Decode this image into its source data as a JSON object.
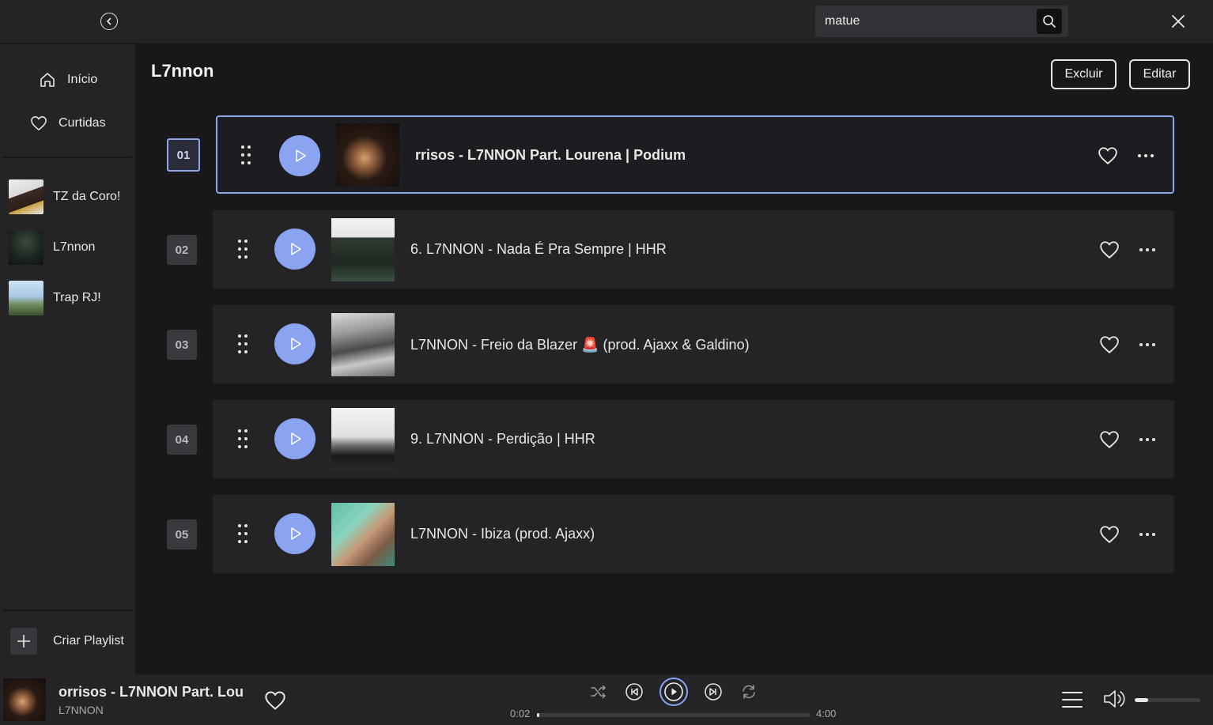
{
  "sidebar": {
    "nav": [
      {
        "label": "Início",
        "icon": "home-icon"
      },
      {
        "label": "Curtidas",
        "icon": "heart-icon"
      }
    ],
    "playlists": [
      {
        "name": "TZ da Coro!"
      },
      {
        "name": "L7nnon"
      },
      {
        "name": "Trap RJ!"
      }
    ],
    "create_label": "Criar Playlist"
  },
  "topbar": {
    "search_value": "matue"
  },
  "playlist": {
    "title": "L7nnon",
    "delete_label": "Excluir",
    "edit_label": "Editar",
    "tracks": [
      {
        "number": "01",
        "title": "rrisos - L7NNON Part. Lourena | Podium",
        "active": true
      },
      {
        "number": "02",
        "title": "6. L7NNON - Nada É Pra Sempre | HHR",
        "active": false
      },
      {
        "number": "03",
        "title": "L7NNON - Freio da Blazer 🚨 (prod. Ajaxx & Galdino)",
        "active": false
      },
      {
        "number": "04",
        "title": "9. L7NNON - Perdição | HHR",
        "active": false
      },
      {
        "number": "05",
        "title": "L7NNON - Ibiza (prod. Ajaxx)",
        "active": false
      }
    ]
  },
  "player": {
    "title": "orrisos - L7NNON Part. Lou",
    "artist": "L7NNON",
    "current_time": "0:02",
    "duration": "4:00",
    "progress_fraction": 0.008,
    "volume_fraction": 0.2
  },
  "colors": {
    "accent": "#8ba4f2",
    "sidebar_bg": "#242427",
    "main_bg": "#18181b"
  }
}
